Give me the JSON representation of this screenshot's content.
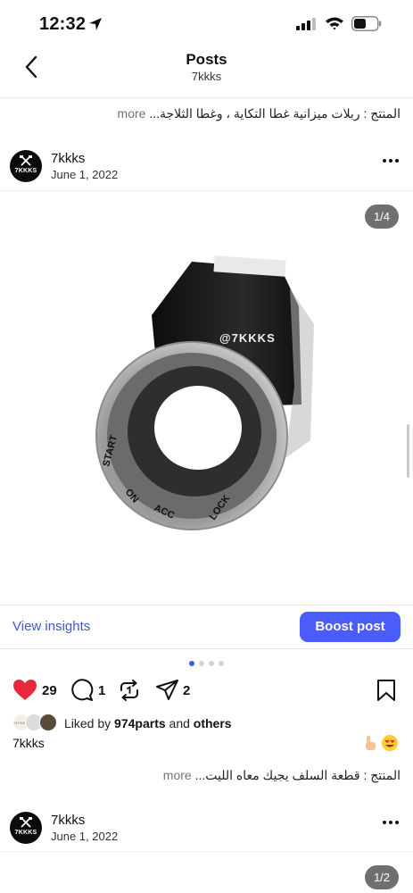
{
  "status_bar": {
    "time": "12:32"
  },
  "nav": {
    "title": "Posts",
    "subtitle": "7kkks"
  },
  "captions": {
    "first": {
      "text": "المنتج : ربلات ميزانية غطا التكاية ، وغطا الثلاجة...",
      "more": "more"
    },
    "second": {
      "text": "المنتج : قطعة السلف يجيك معاه الليت...",
      "more": "more"
    }
  },
  "posts": [
    {
      "username": "7kkks",
      "date": "June 1, 2022",
      "avatar_text": "7KKKS",
      "counter": "1/4",
      "watermark": "@7KKKS"
    },
    {
      "username": "7kkks",
      "date": "June 1, 2022",
      "avatar_text": "7KKKS",
      "counter": "1/2"
    }
  ],
  "product_labels": {
    "start": "START",
    "on": "ON",
    "acc": "ACC",
    "lock": "LOCK"
  },
  "insights": {
    "view_label": "View insights",
    "boost_label": "Boost post"
  },
  "actions": {
    "likes": "29",
    "comments": "1",
    "shares": "2"
  },
  "liked_by": {
    "prefix": "Liked by",
    "user": "974parts",
    "and": "and",
    "others": "others",
    "liker_badge": "974 PARTS"
  },
  "owner_line": "7kkks",
  "colors": {
    "accent": "#4a5df9",
    "link": "#3b57d6",
    "like_red": "#e8283d",
    "active_dot": "#3a5bf0"
  },
  "icons": [
    "location-arrow-icon",
    "signal-icon",
    "wifi-icon",
    "battery-icon",
    "back-chevron-icon",
    "more-options-icon",
    "heart-icon",
    "comment-icon",
    "repost-icon",
    "share-icon",
    "bookmark-icon",
    "hand-emoji-icon",
    "heart-eyes-emoji-icon"
  ]
}
